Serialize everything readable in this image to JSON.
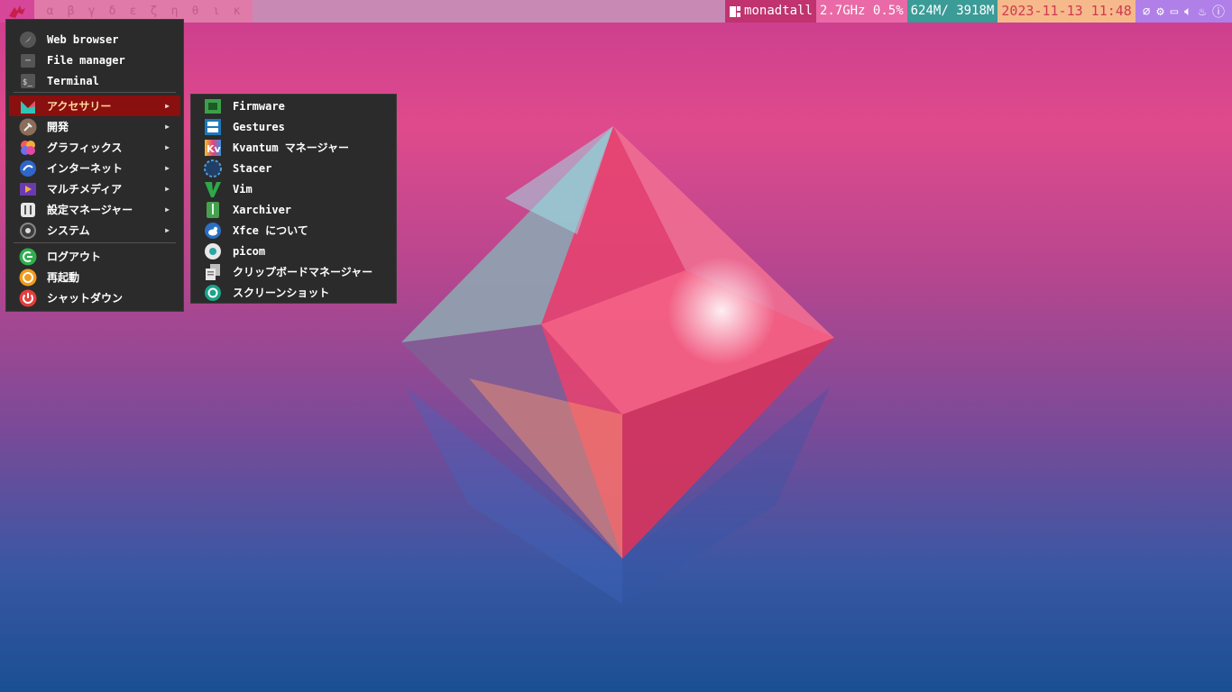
{
  "topbar": {
    "workspaces": [
      "α",
      "β",
      "γ",
      "δ",
      "ε",
      "ζ",
      "η",
      "θ",
      "ι",
      "κ"
    ],
    "layout": "monadtall",
    "cpu": "2.7GHz  0.5%",
    "memory": "624M/ 3918M",
    "clock": "2023-11-13 11:48",
    "tray_icons": [
      "paperclip-icon",
      "gear-icon",
      "display-icon",
      "volume-icon",
      "flame-icon",
      "info-icon"
    ]
  },
  "main_menu": {
    "favorites": [
      {
        "label": "Web browser",
        "icon": "web-browser-icon"
      },
      {
        "label": "File manager",
        "icon": "file-manager-icon"
      },
      {
        "label": "Terminal",
        "icon": "terminal-icon"
      }
    ],
    "categories": [
      {
        "label": "アクセサリー",
        "icon": "accessories-icon"
      },
      {
        "label": "開発",
        "icon": "development-icon"
      },
      {
        "label": "グラフィックス",
        "icon": "graphics-icon"
      },
      {
        "label": "インターネット",
        "icon": "internet-icon"
      },
      {
        "label": "マルチメディア",
        "icon": "multimedia-icon"
      },
      {
        "label": "設定マネージャー",
        "icon": "settings-manager-icon"
      },
      {
        "label": "システム",
        "icon": "system-icon"
      }
    ],
    "session": [
      {
        "label": "ログアウト",
        "icon": "logout-icon"
      },
      {
        "label": "再起動",
        "icon": "restart-icon"
      },
      {
        "label": "シャットダウン",
        "icon": "shutdown-icon"
      }
    ]
  },
  "sub_menu": {
    "items": [
      {
        "label": "Firmware",
        "icon": "firmware-icon"
      },
      {
        "label": "Gestures",
        "icon": "gestures-icon"
      },
      {
        "label": "Kvantum マネージャー",
        "icon": "kvantum-icon"
      },
      {
        "label": "Stacer",
        "icon": "stacer-icon"
      },
      {
        "label": "Vim",
        "icon": "vim-icon"
      },
      {
        "label": "Xarchiver",
        "icon": "xarchiver-icon"
      },
      {
        "label": "Xfce について",
        "icon": "xfce-icon"
      },
      {
        "label": "picom",
        "icon": "picom-icon"
      },
      {
        "label": "クリップボードマネージャー",
        "icon": "clipboard-icon"
      },
      {
        "label": "スクリーンショット",
        "icon": "screenshot-icon"
      }
    ]
  },
  "colors": {
    "active_item_bg": "#8a0f0f",
    "active_item_text": "#ffd9a0",
    "menu_bg": "#2b2b2b"
  }
}
